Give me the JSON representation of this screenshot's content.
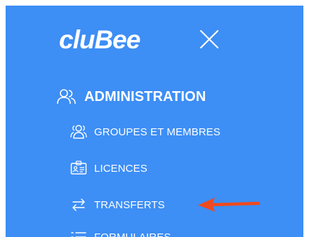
{
  "brand": {
    "logo_text": "cluBee"
  },
  "sidebar": {
    "section": {
      "label": "ADMINISTRATION",
      "icon": "users-icon"
    },
    "items": [
      {
        "label": "GROUPES ET MEMBRES",
        "icon": "group-icon"
      },
      {
        "label": "LICENCES",
        "icon": "id-card-icon"
      },
      {
        "label": "TRANSFERTS",
        "icon": "transfer-arrows-icon"
      },
      {
        "label": "FORMULAIRES",
        "icon": "list-icon"
      }
    ]
  },
  "colors": {
    "panel": "#3d8ef5",
    "text": "#ffffff",
    "annotation_arrow": "#f04a1e"
  }
}
